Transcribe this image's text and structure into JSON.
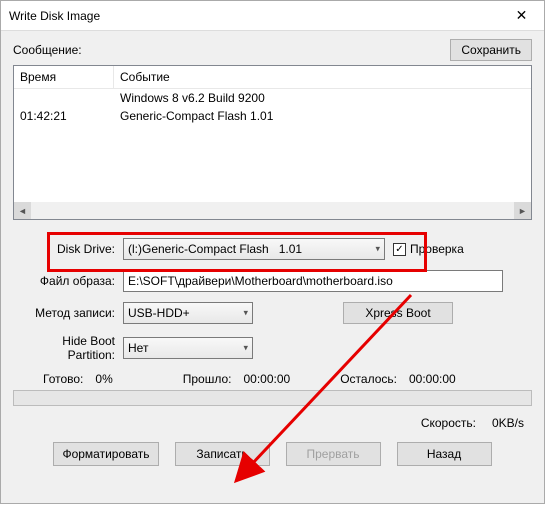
{
  "window": {
    "title": "Write Disk Image"
  },
  "topline": {
    "label": "Сообщение:",
    "save_button": "Сохранить"
  },
  "log": {
    "col_time": "Время",
    "col_event": "Событие",
    "rows": [
      {
        "time": "",
        "event": "Windows 8 v6.2 Build 9200"
      },
      {
        "time": "01:42:21",
        "event": "Generic-Compact Flash   1.01"
      }
    ]
  },
  "form": {
    "disk_drive_label": "Disk Drive:",
    "disk_drive_value": "(l:)Generic-Compact Flash   1.01",
    "verify_label": "Проверка",
    "verify_checked": true,
    "image_file_label": "Файл образа:",
    "image_file_value": "E:\\SOFT\\драйвери\\Motherboard\\motherboard.iso",
    "write_method_label": "Метод записи:",
    "write_method_value": "USB-HDD+",
    "xpress_boot": "Xpress Boot",
    "hide_boot_label": "Hide Boot Partition:",
    "hide_boot_value": "Нет"
  },
  "status": {
    "ready_label": "Готово:",
    "ready_value": "0%",
    "elapsed_label": "Прошло:",
    "elapsed_value": "00:00:00",
    "remaining_label": "Осталось:",
    "remaining_value": "00:00:00"
  },
  "speed": {
    "label": "Скорость:",
    "value": "0KB/s"
  },
  "buttons": {
    "format": "Форматировать",
    "write": "Записать",
    "abort": "Прервать",
    "back": "Назад"
  }
}
